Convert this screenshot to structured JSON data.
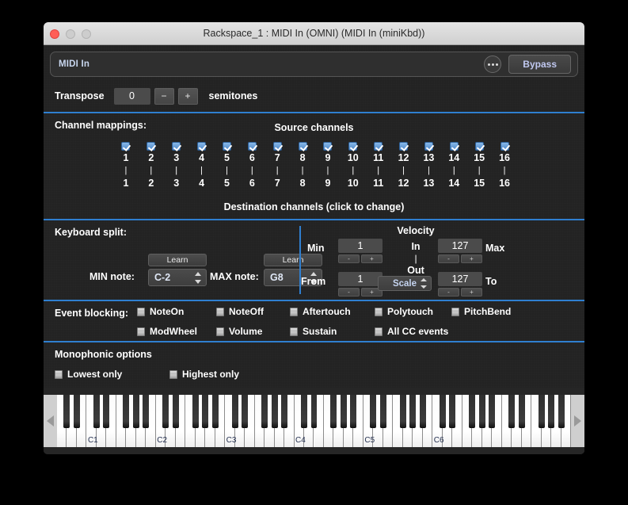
{
  "window": {
    "title": "Rackspace_1 : MIDI In (OMNI) (MIDI In (miniKbd))",
    "traffic_lights": [
      "close",
      "minimize",
      "maximize"
    ]
  },
  "plugin_header": {
    "name": "MIDI In",
    "menu_icon": "ellipsis-icon",
    "bypass_label": "Bypass"
  },
  "transpose": {
    "label": "Transpose",
    "value": "0",
    "minus_label": "−",
    "plus_label": "+",
    "units_label": "semitones"
  },
  "channel_mappings": {
    "title": "Channel mappings:",
    "source_label": "Source channels",
    "destination_label": "Destination channels (click to change)",
    "connector": "|",
    "source": [
      "1",
      "2",
      "3",
      "4",
      "5",
      "6",
      "7",
      "8",
      "9",
      "10",
      "11",
      "12",
      "13",
      "14",
      "15",
      "16"
    ],
    "destination": [
      "1",
      "2",
      "3",
      "4",
      "5",
      "6",
      "7",
      "8",
      "9",
      "10",
      "11",
      "12",
      "13",
      "14",
      "15",
      "16"
    ],
    "enabled": [
      true,
      true,
      true,
      true,
      true,
      true,
      true,
      true,
      true,
      true,
      true,
      true,
      true,
      true,
      true,
      true
    ]
  },
  "keyboard_split": {
    "title": "Keyboard split:",
    "learn_label": "Learn",
    "min_note_label": "MIN note:",
    "min_note_value": "C-2",
    "max_note_label": "MAX note:",
    "max_note_value": "G8"
  },
  "velocity": {
    "title": "Velocity",
    "in_label": "In",
    "out_label": "Out",
    "pipe": "|",
    "min_label": "Min",
    "min_value": "1",
    "max_label": "Max",
    "max_value": "127",
    "from_label": "From",
    "from_value": "1",
    "to_label": "To",
    "to_value": "127",
    "curve_value": "Scale",
    "minus_label": "-",
    "plus_label": "+"
  },
  "event_blocking": {
    "title": "Event blocking:",
    "row1": [
      {
        "label": "NoteOn",
        "checked": false
      },
      {
        "label": "NoteOff",
        "checked": false
      },
      {
        "label": "Aftertouch",
        "checked": false
      },
      {
        "label": "Polytouch",
        "checked": false
      },
      {
        "label": "PitchBend",
        "checked": false
      }
    ],
    "row2": [
      {
        "label": "ModWheel",
        "checked": false
      },
      {
        "label": "Volume",
        "checked": false
      },
      {
        "label": "Sustain",
        "checked": false
      },
      {
        "label": "All CC events",
        "checked": false
      }
    ]
  },
  "monophonic": {
    "title": "Monophonic options",
    "options": [
      {
        "label": "Lowest only",
        "checked": false
      },
      {
        "label": "Highest only",
        "checked": false
      }
    ]
  },
  "keyboard": {
    "scroll_left_icon": "triangle-left-icon",
    "scroll_right_icon": "triangle-right-icon",
    "octave_labels": [
      "C1",
      "C2",
      "C3",
      "C4",
      "C5",
      "C6"
    ]
  },
  "colors": {
    "accent_blue": "#2f7fd0",
    "panel_bg": "#232323",
    "text": "#ffffff",
    "link_blue": "#c8d6ee"
  }
}
